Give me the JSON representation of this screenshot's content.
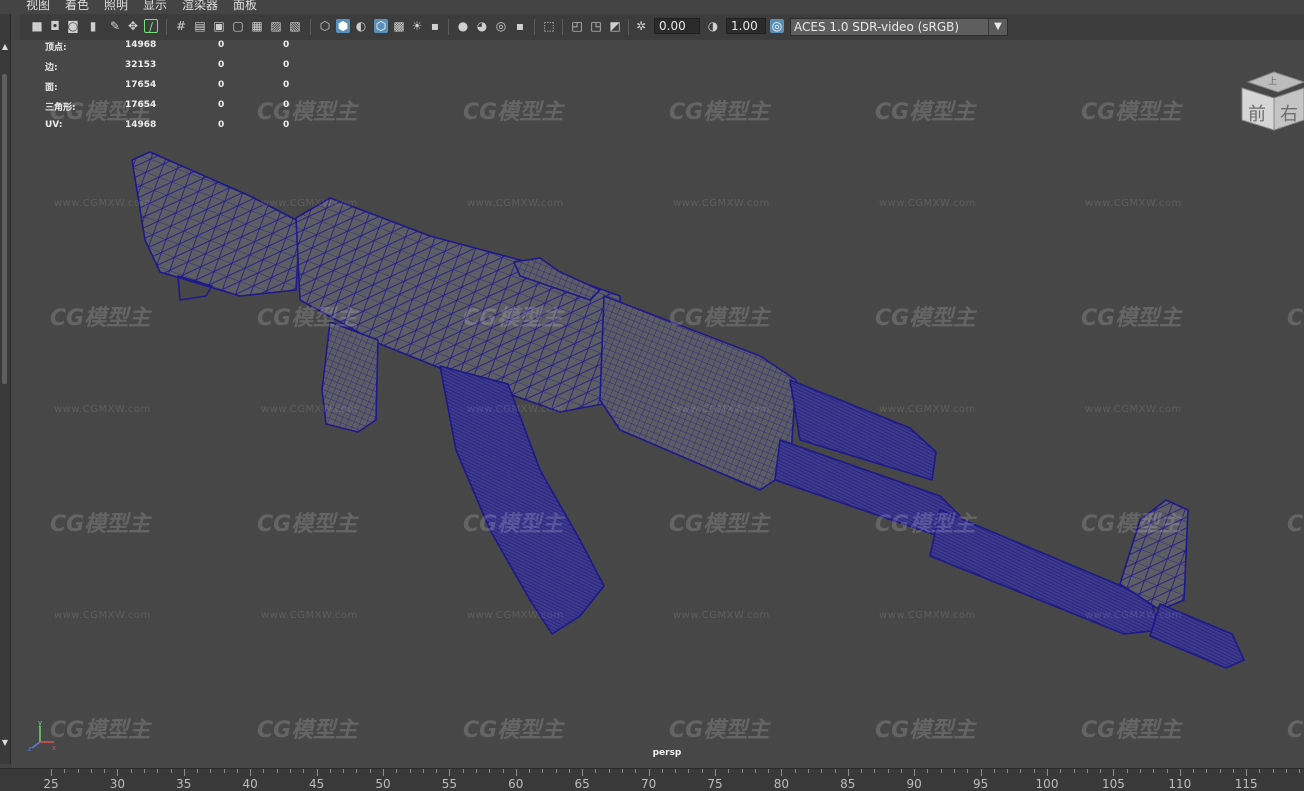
{
  "menubar": {
    "items": [
      "视图",
      "着色",
      "照明",
      "显示",
      "渲染器",
      "面板"
    ]
  },
  "toolbar": {
    "exposure_value": "0.00",
    "gamma_value": "1.00",
    "color_space": "ACES 1.0 SDR-video (sRGB)",
    "icons": [
      "camera-select-icon",
      "camera-attributes-icon",
      "bookmark-icon",
      "image-plane-icon",
      "grease-pencil-icon",
      "2d-pan-zoom-icon",
      "grid-icon",
      "film-gate-icon",
      "resolution-gate-icon",
      "gate-mask-icon",
      "field-chart-icon",
      "safe-action-icon",
      "safe-title-icon",
      "wireframe-icon",
      "smooth-shade-icon",
      "default-material-icon",
      "wireframe-on-shaded-icon",
      "textured-icon",
      "lights-icon",
      "shadows-icon",
      "screen-space-ao-icon",
      "motion-blur-icon",
      "anti-aliasing-icon",
      "depth-of-field-icon",
      "isolate-select-icon",
      "xray-icon",
      "xray-joints-icon",
      "backface-culling-icon",
      "exposure-icon",
      "gamma-icon",
      "view-transform-icon"
    ]
  },
  "hud": {
    "rows": [
      {
        "label": "顶点:",
        "v1": "14968",
        "v2": "0",
        "v3": "0"
      },
      {
        "label": "边:",
        "v1": "32153",
        "v2": "0",
        "v3": "0"
      },
      {
        "label": "面:",
        "v1": "17654",
        "v2": "0",
        "v3": "0"
      },
      {
        "label": "三角形:",
        "v1": "17654",
        "v2": "0",
        "v3": "0"
      },
      {
        "label": "UV:",
        "v1": "14968",
        "v2": "0",
        "v3": "0"
      }
    ]
  },
  "viewcube": {
    "face_front": "前",
    "face_right": "右",
    "face_top": "上"
  },
  "axis": {
    "x": "x",
    "y": "y",
    "z": "z"
  },
  "camera_label": "persp",
  "watermark": {
    "logo": "CG模型主",
    "url": "www.CGMXW.com"
  },
  "timeline": {
    "ticks": [
      "25",
      "30",
      "35",
      "40",
      "45",
      "50",
      "55",
      "60",
      "65",
      "70",
      "75",
      "80",
      "85",
      "90",
      "95",
      "100",
      "105",
      "110",
      "115"
    ]
  },
  "colors": {
    "viewport_bg": "#474747",
    "wireframe": "#1e1a8c",
    "mesh_fill": "#5f5f66",
    "accent": "#5a8fb8"
  }
}
